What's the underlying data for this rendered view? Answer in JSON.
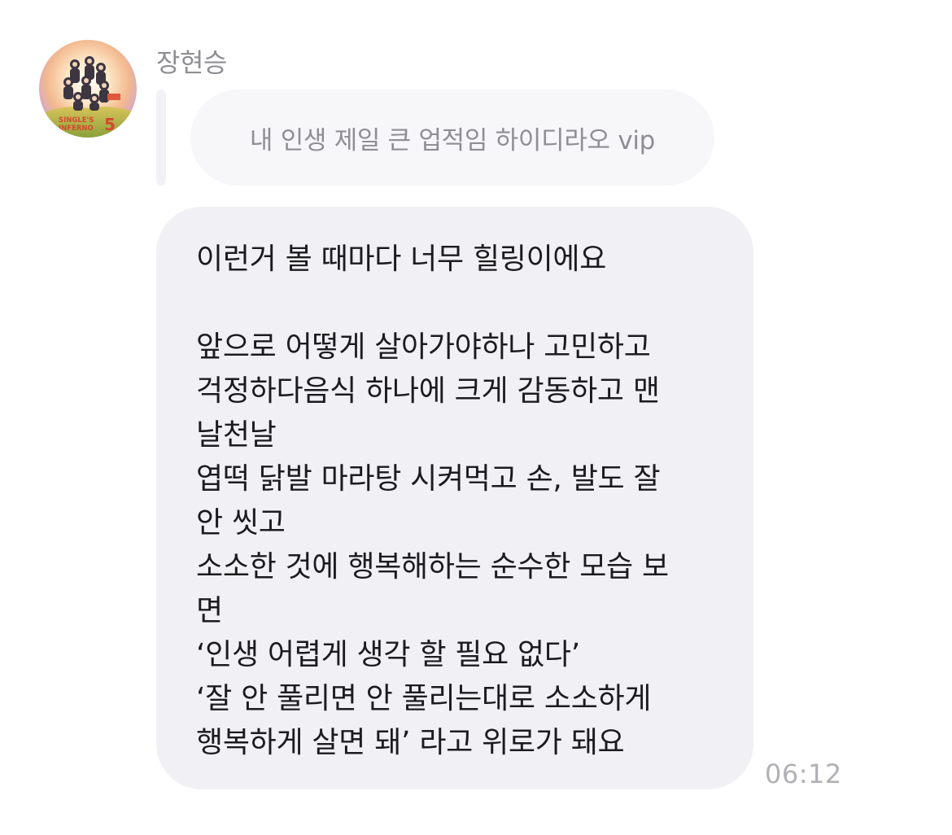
{
  "sender": {
    "name": "장현승",
    "avatar": {
      "icon": "profile-photo",
      "caption_lines": [
        "SINGLE'S",
        "INFERNO",
        "5"
      ]
    }
  },
  "quoted_message": {
    "text": "내 인생 제일 큰 업적임 하이디라오 vip"
  },
  "message": {
    "lines": [
      "이런거 볼 때마다 너무 힐링이에요",
      "",
      "앞으로 어떻게 살아가야하나 고민하고",
      "걱정하다음식 하나에 크게 감동하고 맨",
      "날천날",
      "엽떡 닭발 마라탕 시켜먹고 손, 발도 잘",
      "안 씻고",
      "소소한 것에 행복해하는 순수한 모습 보",
      "면",
      "‘인생 어렵게 생각 할 필요 없다’",
      "‘잘 안 풀리면 안 풀리는대로 소소하게",
      "행복하게 살면 돼’ 라고 위로가 돼요"
    ],
    "timestamp": "06:12"
  },
  "colors": {
    "bubble": "#f1f1f5",
    "quoted_bubble": "#f7f7fa",
    "text": "#1c1c1e",
    "muted_text": "#8e8e93",
    "timestamp": "#b0b0b6"
  }
}
